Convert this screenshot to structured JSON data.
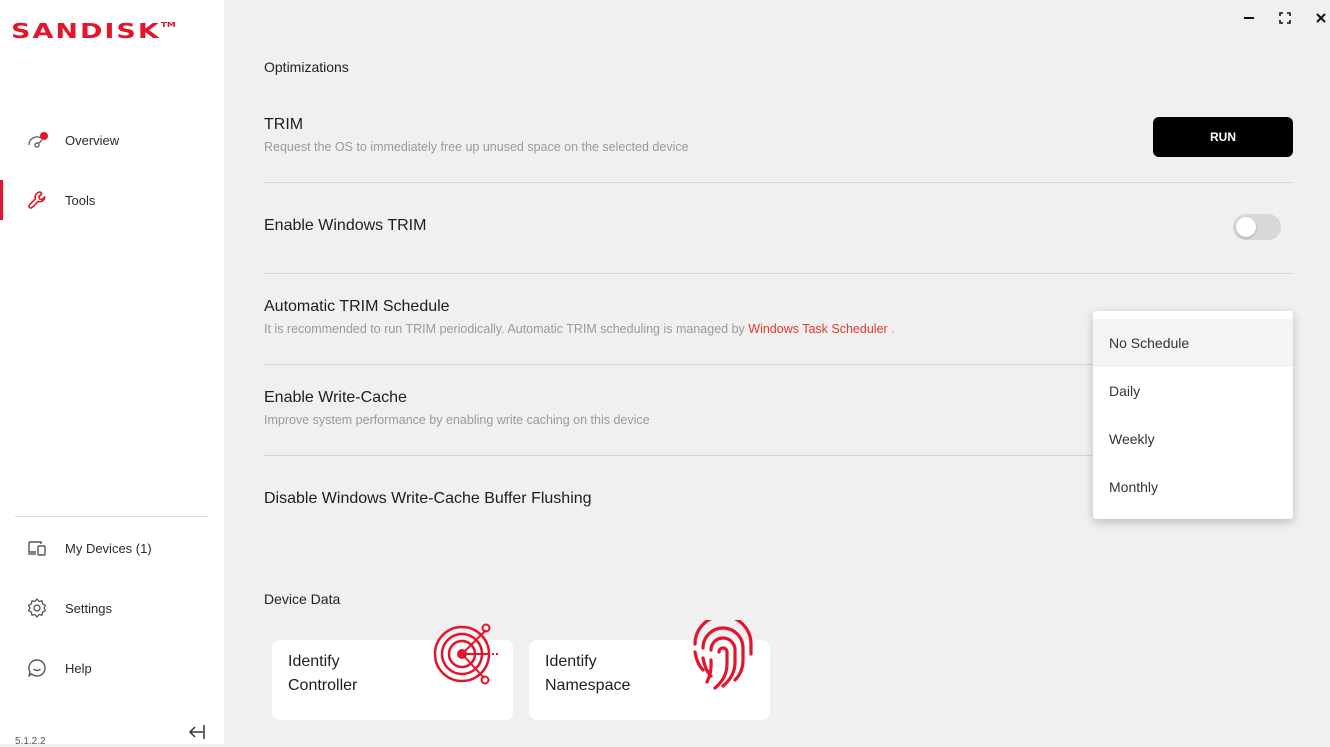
{
  "app": {
    "logo": "SANDISK",
    "trademark": "TM",
    "version": "5.1.2.2",
    "brand_color": "#e4142b"
  },
  "window_controls": {
    "minimize_icon": "minimize-icon",
    "maximize_icon": "maximize-icon",
    "close_icon": "close-icon"
  },
  "sidebar": {
    "items": [
      {
        "label": "Overview",
        "icon": "overview-gauge-icon",
        "active": false
      },
      {
        "label": "Tools",
        "icon": "wrench-icon",
        "active": true
      }
    ],
    "bottom_items": [
      {
        "label": "My Devices (1)",
        "icon": "devices-icon"
      },
      {
        "label": "Settings",
        "icon": "gear-icon"
      },
      {
        "label": "Help",
        "icon": "help-chat-icon"
      }
    ],
    "collapse_icon": "collapse-sidebar-icon"
  },
  "optimizations": {
    "section_title": "Optimizations",
    "trim": {
      "title": "TRIM",
      "description": "Request the OS to immediately free up unused space on the selected device",
      "button_label": "RUN"
    },
    "windows_trim": {
      "title": "Enable Windows TRIM",
      "enabled": false
    },
    "trim_schedule": {
      "title": "Automatic TRIM Schedule",
      "description": "It is recommended to run TRIM periodically. Automatic TRIM scheduling is managed by",
      "link_text": "Windows Task Scheduler",
      "description_end": ".",
      "options": [
        "No Schedule",
        "Daily",
        "Weekly",
        "Monthly"
      ],
      "selected": "No Schedule"
    },
    "write_cache": {
      "title": "Enable Write-Cache",
      "description": "Improve system performance by enabling write caching on this device"
    },
    "buffer_flushing": {
      "title": "Disable Windows Write-Cache Buffer Flushing"
    }
  },
  "device_data": {
    "section_title": "Device Data",
    "cards": [
      {
        "title": "Identify Controller",
        "icon": "target-icon"
      },
      {
        "title": "Identify Namespace",
        "icon": "fingerprint-icon"
      }
    ]
  }
}
